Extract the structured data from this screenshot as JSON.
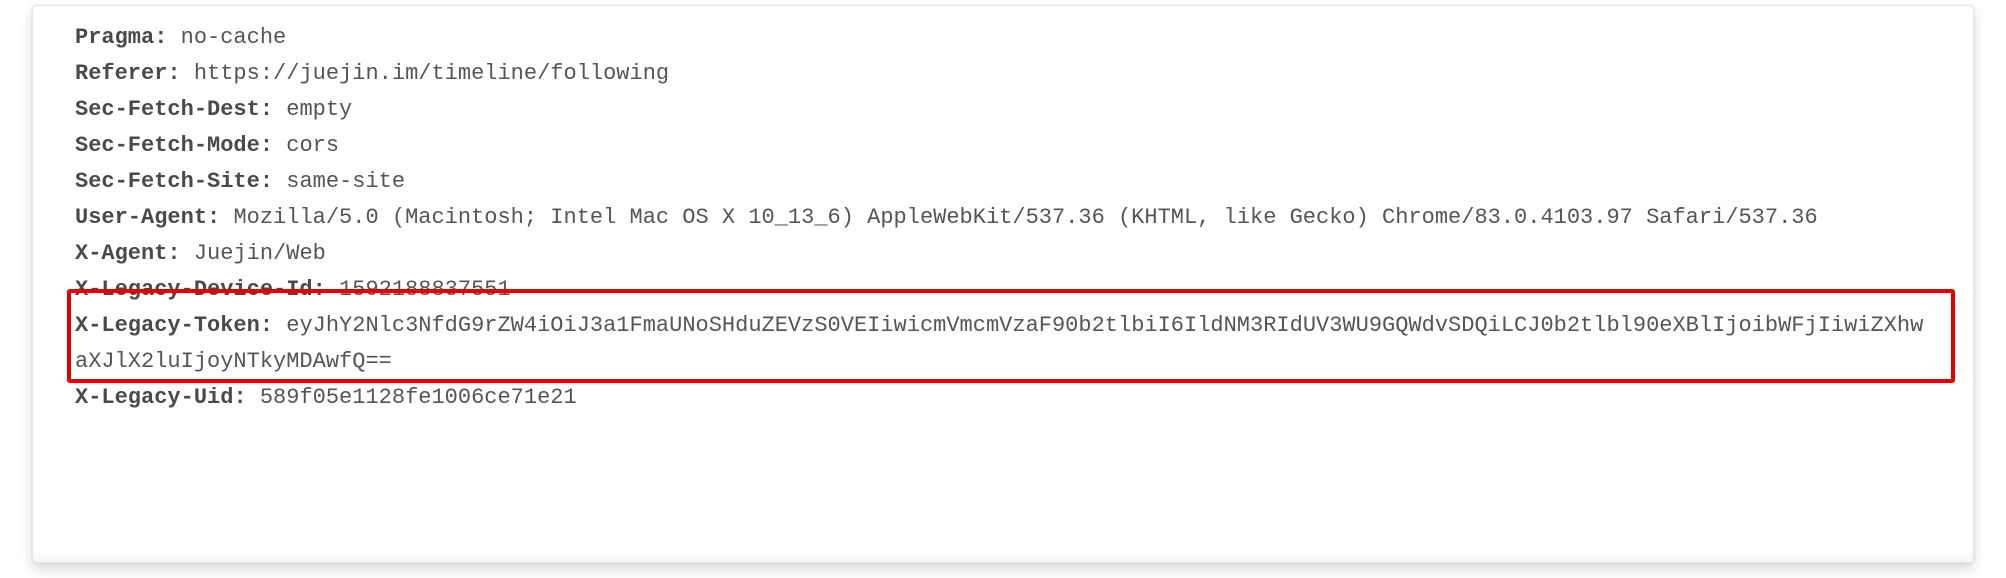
{
  "headers": [
    {
      "name": "Pragma",
      "value": "no-cache"
    },
    {
      "name": "Referer",
      "value": "https://juejin.im/timeline/following"
    },
    {
      "name": "Sec-Fetch-Dest",
      "value": "empty"
    },
    {
      "name": "Sec-Fetch-Mode",
      "value": "cors"
    },
    {
      "name": "Sec-Fetch-Site",
      "value": "same-site"
    },
    {
      "name": "User-Agent",
      "value": "Mozilla/5.0 (Macintosh; Intel Mac OS X 10_13_6) AppleWebKit/537.36 (KHTML, like Gecko) Chrome/83.0.4103.97 Safari/537.36"
    },
    {
      "name": "X-Agent",
      "value": "Juejin/Web"
    },
    {
      "name": "X-Legacy-Device-Id",
      "value": "1592188837551"
    },
    {
      "name": "X-Legacy-Token",
      "value": "eyJhY2Nlc3NfdG9rZW4iOiJ3a1FmaUNoSHduZEVzS0VEIiwicmVmcmVzaF90b2tlbiI6IldNM3RIdUV3WU9GQWdvSDQiLCJ0b2tlbl90eXBlIjoibWFjIiwiZXhwaXJlX2luIjoyNTkyMDAwfQ=="
    },
    {
      "name": "X-Legacy-Uid",
      "value": "589f05e1128fe1006ce71e21"
    }
  ],
  "highlighted_header_index": 8
}
